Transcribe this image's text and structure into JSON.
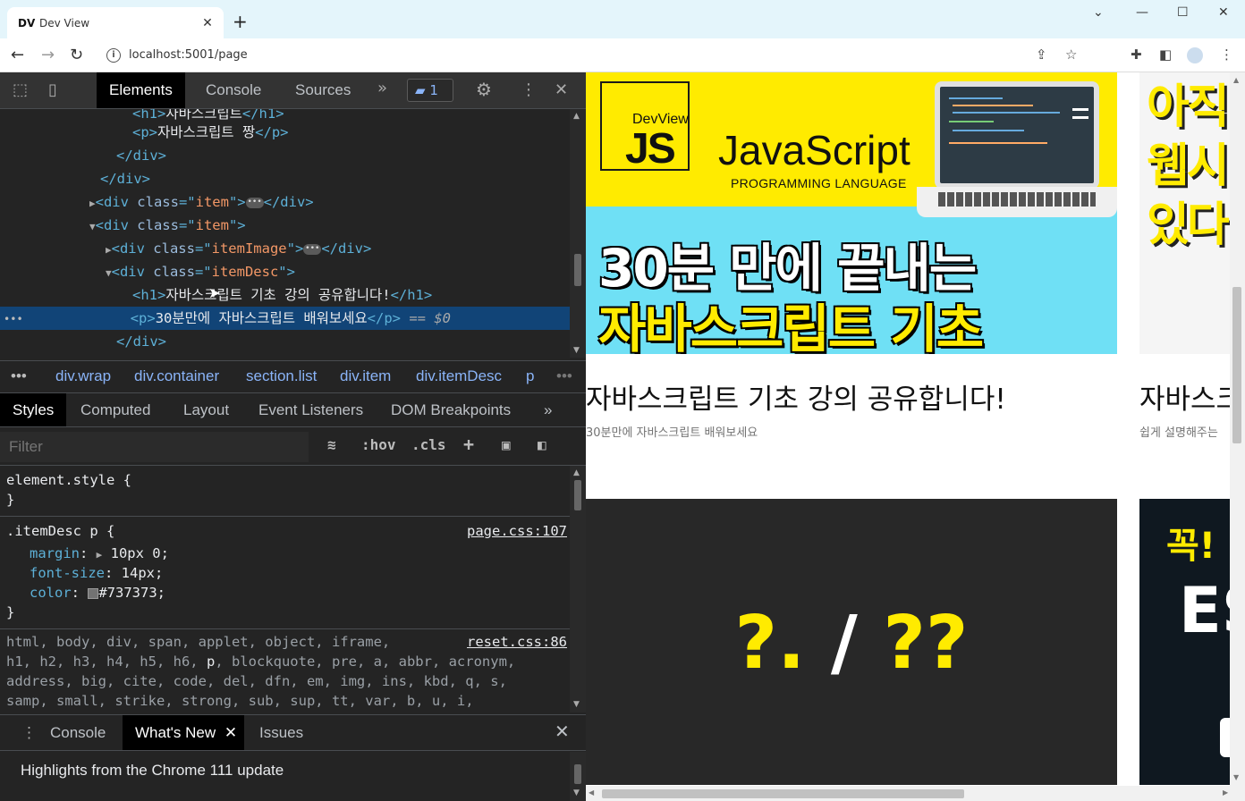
{
  "browser": {
    "tab_favicon": "DV",
    "tab_title": "Dev View",
    "url": "localhost:5001/page"
  },
  "devtools": {
    "tabs": [
      "Elements",
      "Console",
      "Sources"
    ],
    "active_tab": "Elements",
    "message_count": "1",
    "dom": {
      "line0": "자바스크립트",
      "line1_text": "자바스크립트 짱",
      "item_cls": "item",
      "item_image_cls": "itemImage",
      "item_desc_cls": "itemDesc",
      "h1_text": "자바스크립트 기초 강의 공유합니다!",
      "p_text": "30분만에 자바스크립트 배워보세요",
      "selected_suffix": "== $0"
    },
    "breadcrumbs": [
      "div.wrap",
      "div.container",
      "section.list",
      "div.item",
      "div.itemDesc",
      "p"
    ],
    "subtabs": [
      "Styles",
      "Computed",
      "Layout",
      "Event Listeners",
      "DOM Breakpoints"
    ],
    "active_subtab": "Styles",
    "filter_placeholder": "Filter",
    "hov": ":hov",
    "cls": ".cls",
    "styles": {
      "element_style": "element.style {",
      "close": "}",
      "rule1_selector": ".itemDesc p {",
      "rule1_source": "page.css:107",
      "margin_prop": "margin",
      "margin_val": "10px 0;",
      "fontsize_prop": "font-size",
      "fontsize_val": "14px;",
      "color_prop": "color",
      "color_val": "#737373;",
      "reset_source": "reset.css:86",
      "reset_l1": "html, body, div, span, applet, object, iframe,",
      "reset_l2a": "h1, h2, h3, h4, h5, h6, ",
      "reset_l2b": "p",
      "reset_l2c": ", blockquote, pre, a, abbr, acronym,",
      "reset_l3": "address, big, cite, code, del, dfn, em, img, ins, kbd, q, s,",
      "reset_l4": "samp, small, strike, strong, sub, sup, tt, var, b, u, i,"
    },
    "drawer_tabs": [
      "Console",
      "What's New",
      "Issues"
    ],
    "active_drawer_tab": "What's New",
    "drawer_text": "Highlights from the Chrome 111 update"
  },
  "page": {
    "card1": {
      "logo_small": "DevView",
      "logo_js": "JS",
      "logo_word": "JavaScript",
      "logo_sub": "PROGRAMMING LANGUAGE",
      "banner_line1": "30분 만에 끝내는",
      "banner_line2": "자바스크립트 기초",
      "title": "자바스크립트 기초 강의 공유합니다!",
      "desc": "30분만에 자바스크립트 배워보세요"
    },
    "card2": {
      "line1": "아직",
      "line2": "웹시",
      "line3": "있다",
      "title": "자바스크",
      "desc": "쉽게 설명해주는"
    },
    "card3": {
      "text_a": "?.",
      "text_slash": " / ",
      "text_b": "??"
    },
    "card4": {
      "line1": "꼭! 알",
      "line2": "ES"
    }
  }
}
